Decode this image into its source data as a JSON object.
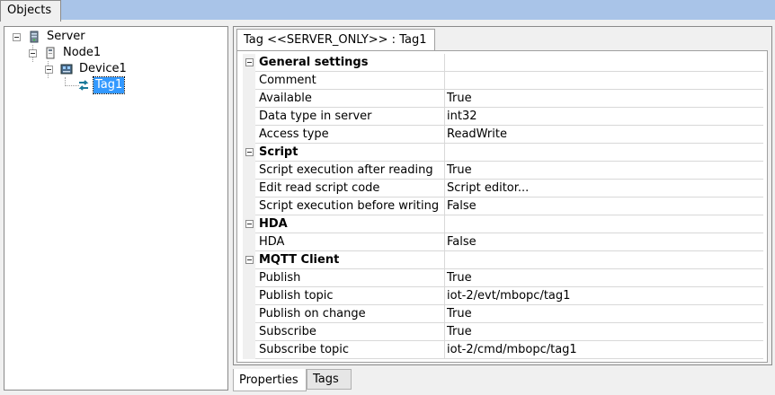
{
  "objects_tab": {
    "label": "Objects"
  },
  "tree": {
    "server": {
      "label": "Server",
      "icon": "server-icon"
    },
    "node": {
      "label": "Node1",
      "icon": "node-icon"
    },
    "device": {
      "label": "Device1",
      "icon": "device-icon"
    },
    "tag": {
      "label": "Tag1",
      "icon": "tag-icon",
      "selected": true
    }
  },
  "document_tab": {
    "label": "Tag <<SERVER_ONLY>> : Tag1"
  },
  "properties": {
    "groups": [
      {
        "name": "General settings",
        "rows": [
          {
            "name": "Comment",
            "value": ""
          },
          {
            "name": "Available",
            "value": "True"
          },
          {
            "name": "Data type in server",
            "value": "int32"
          },
          {
            "name": "Access type",
            "value": "ReadWrite"
          }
        ]
      },
      {
        "name": "Script",
        "rows": [
          {
            "name": "Script execution after reading",
            "value": "True"
          },
          {
            "name": "Edit read script code",
            "value": "Script editor..."
          },
          {
            "name": "Script execution before writing",
            "value": "False"
          }
        ]
      },
      {
        "name": "HDA",
        "rows": [
          {
            "name": "HDA",
            "value": "False"
          }
        ]
      },
      {
        "name": "MQTT Client",
        "rows": [
          {
            "name": "Publish",
            "value": "True"
          },
          {
            "name": "Publish topic",
            "value": "iot-2/evt/mbopc/tag1"
          },
          {
            "name": "Publish on change",
            "value": "True"
          },
          {
            "name": "Subscribe",
            "value": "True"
          },
          {
            "name": "Subscribe topic",
            "value": "iot-2/cmd/mbopc/tag1"
          }
        ]
      }
    ]
  },
  "bottom_tabs": [
    {
      "label": "Properties",
      "active": true
    },
    {
      "label": "Tags",
      "active": false
    }
  ],
  "colors": {
    "tab_strip": "#a9c4e8",
    "selection": "#3399ff"
  }
}
